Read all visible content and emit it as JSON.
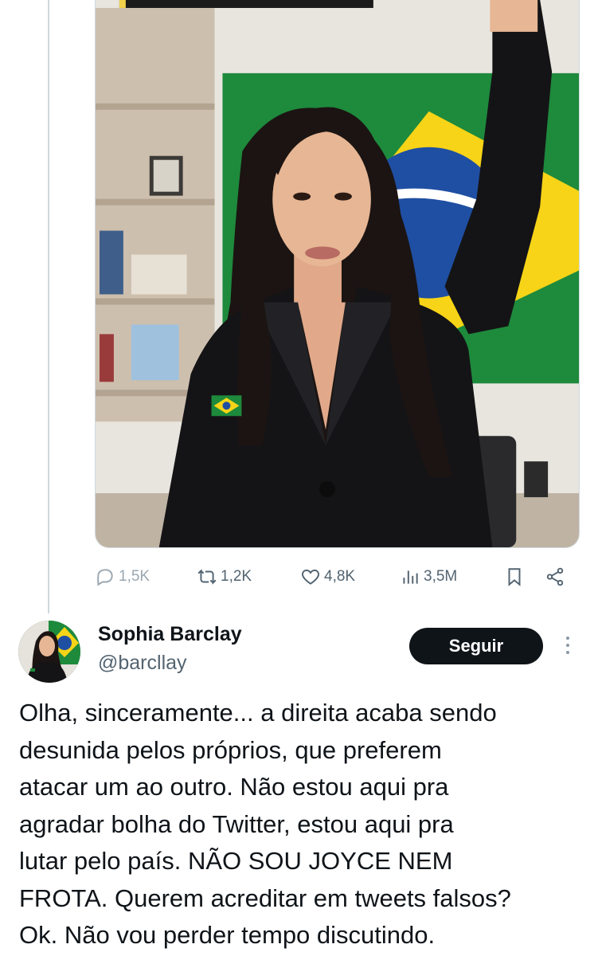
{
  "tweet_media": {
    "description_icon": "photo"
  },
  "actions": {
    "reply_count": "1,5K",
    "retweet_count": "1,2K",
    "like_count": "4,8K",
    "view_count": "3,5M"
  },
  "author": {
    "name": "Sophia Barclay",
    "handle": "@barcllay",
    "follow_label": "Seguir"
  },
  "tweet": {
    "lines": [
      "Olha, sinceramente... a direita acaba sendo",
      "desunida pelos próprios, que preferem",
      "atacar um ao outro. Não estou aqui pra",
      "agradar bolha do Twitter, estou aqui pra",
      "lutar pelo país. NÃO SOU JOYCE NEM",
      "FROTA. Querem acreditar em tweets falsos?",
      "Ok. Não vou perder tempo discutindo."
    ]
  },
  "colors": {
    "text_primary": "#0f1419",
    "text_secondary": "#536471",
    "follow_bg": "#0f1419",
    "flag_green": "#1e8a3c",
    "flag_yellow": "#f7d417",
    "flag_blue": "#1f4fa3"
  }
}
